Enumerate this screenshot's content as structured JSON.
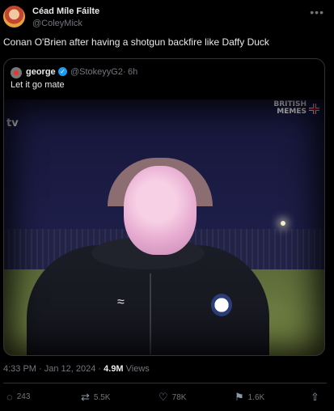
{
  "author": {
    "display_name": "Céad Míle Fáilte",
    "handle": "@ColeyMick"
  },
  "tweet": {
    "text": "Conan O'Brien after having a shotgun backfire like Daffy Duck"
  },
  "quote": {
    "name": "george",
    "handle": "@StokeyyG2",
    "separator": "·",
    "time": "6h",
    "text": "Let it go mate",
    "media": {
      "watermark_line1": "BRITISH",
      "watermark_line2": "MEMES",
      "channel_logo": "tv"
    }
  },
  "meta": {
    "timestamp": "4:33 PM · Jan 12, 2024 · ",
    "views_count": "4.9M",
    "views_label": " Views"
  },
  "actions": {
    "replies": "243",
    "reposts": "5.5K",
    "likes": "78K",
    "bookmarks": "1.6K"
  },
  "icons": {
    "more": "more-icon",
    "verified": "verified-icon",
    "reply": "reply-icon",
    "repost": "repost-icon",
    "like": "like-icon",
    "bookmark": "bookmark-icon",
    "share": "share-icon"
  },
  "colors": {
    "background": "#000000",
    "text": "#e7e9ea",
    "muted": "#71767b",
    "verified": "#1d9bf0",
    "border": "#2f3336"
  }
}
